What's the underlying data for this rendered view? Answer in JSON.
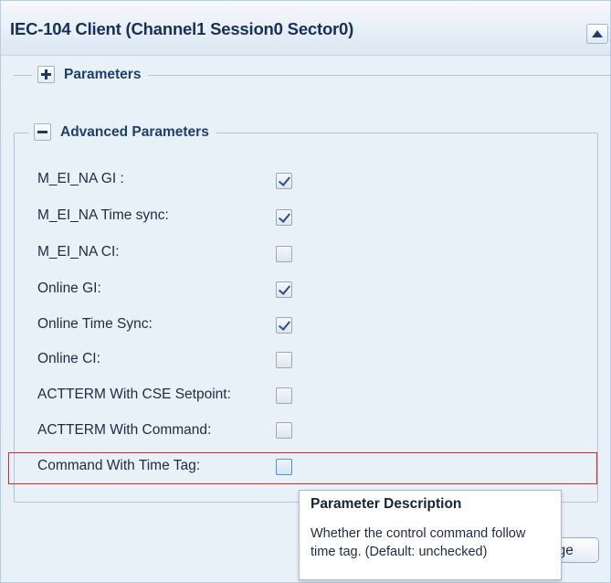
{
  "panel": {
    "title": "IEC-104 Client (Channel1 Session0 Sector0)"
  },
  "parameters_group": {
    "label": "Parameters",
    "state": "collapsed"
  },
  "advanced_group": {
    "label": "Advanced Parameters",
    "state": "expanded",
    "rows": [
      {
        "label": "M_EI_NA GI :",
        "checked": true
      },
      {
        "label": "M_EI_NA Time sync:",
        "checked": true
      },
      {
        "label": "M_EI_NA CI:",
        "checked": false
      },
      {
        "label": "Online GI:",
        "checked": true
      },
      {
        "label": "Online Time Sync:",
        "checked": true
      },
      {
        "label": "Online CI:",
        "checked": false
      },
      {
        "label": "ACTTERM With CSE Setpoint:",
        "checked": false
      },
      {
        "label": "ACTTERM With Command:",
        "checked": false
      },
      {
        "label": "Command With Time Tag:",
        "checked": false,
        "highlighted": true
      }
    ]
  },
  "tooltip": {
    "title": "Parameter Description",
    "body": "Whether the control command follow time tag. (Default: unchecked)"
  },
  "change_button": {
    "label_visible": "nge"
  },
  "colors": {
    "panel_bg": "#e9f1f8",
    "title_text": "#15305a",
    "highlight_border": "#e0242c",
    "check_mark": "#2d4f86"
  }
}
